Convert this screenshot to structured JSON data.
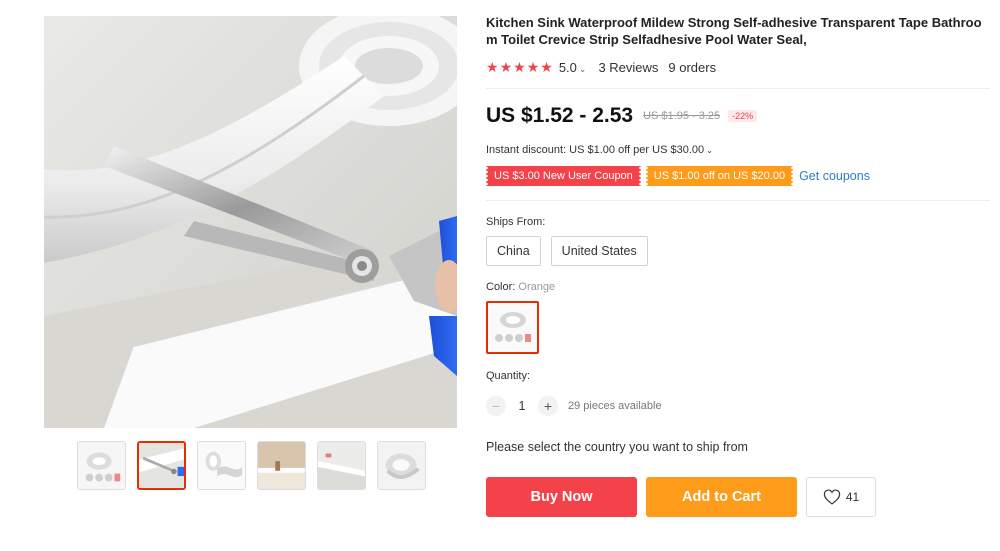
{
  "product": {
    "title": "Kitchen Sink Waterproof Mildew Strong Self-adhesive Transparent Tape Bathroom Toilet Crevice Strip Selfadhesive Pool Water Seal,",
    "rating": "5.0",
    "stars_filled": 5,
    "reviews": "3 Reviews",
    "orders": "9 orders"
  },
  "price": {
    "current": "US $1.52 - 2.53",
    "original": "US $1.95 - 3.25",
    "discount": "-22%"
  },
  "promo": {
    "instant_discount": "Instant discount: US $1.00 off per US $30.00",
    "coupons": [
      {
        "label": "US $3.00 New User Coupon",
        "color": "#f4424b"
      },
      {
        "label": "US $1.00 off on US $20.00",
        "color": "#ff9b1a"
      }
    ],
    "get_coupons": "Get coupons"
  },
  "shipping": {
    "label": "Ships From:",
    "options": [
      "China",
      "United States"
    ]
  },
  "color": {
    "label": "Color:",
    "selected": "Orange"
  },
  "quantity": {
    "label": "Quantity:",
    "value": "1",
    "minus": "−",
    "plus": "+",
    "available": "29 pieces available"
  },
  "ship_message": "Please select the country you want to ship from",
  "actions": {
    "buy_now": "Buy Now",
    "add_to_cart": "Add to Cart",
    "wishlist_count": "41"
  },
  "gallery": {
    "selected_index": 1,
    "thumbnail_count": 6
  },
  "colors": {
    "accent_red": "#f4424b",
    "accent_orange": "#ff9b1a",
    "link_blue": "#2e7bcf"
  }
}
